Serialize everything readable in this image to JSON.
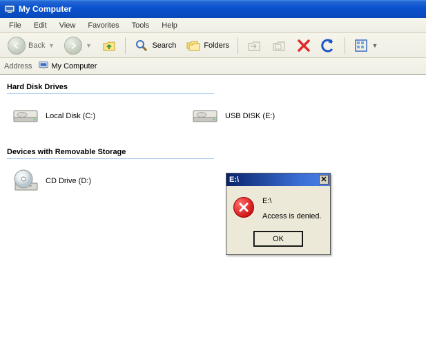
{
  "window": {
    "title": "My Computer"
  },
  "menubar": {
    "file": "File",
    "edit": "Edit",
    "view": "View",
    "favorites": "Favorites",
    "tools": "Tools",
    "help": "Help"
  },
  "toolbar": {
    "back": "Back",
    "search": "Search",
    "folders": "Folders"
  },
  "addressbar": {
    "label": "Address",
    "value": "My Computer"
  },
  "groups": {
    "hdd": {
      "header": "Hard Disk Drives",
      "local_disk": "Local Disk (C:)",
      "usb_disk": "USB DISK (E:)"
    },
    "removable": {
      "header": "Devices with Removable Storage",
      "cd_drive": "CD Drive (D:)"
    }
  },
  "dialog": {
    "title": "E:\\",
    "line1": "E:\\",
    "line2": "Access is denied.",
    "ok": "OK"
  },
  "colors": {
    "titlebar_gradient": "#0b54d0",
    "dialog_bg": "#ece9d8",
    "error_red": "#d41a1a"
  }
}
